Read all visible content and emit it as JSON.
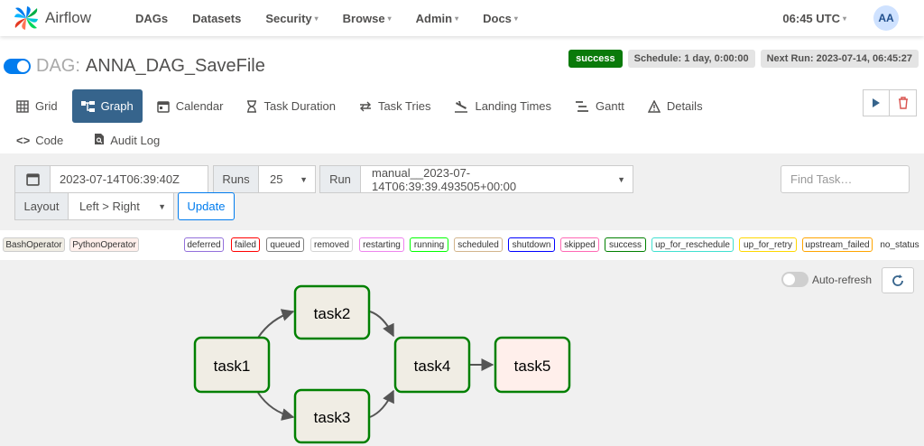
{
  "navbar": {
    "brand": "Airflow",
    "items": [
      {
        "label": "DAGs",
        "dropdown": false
      },
      {
        "label": "Datasets",
        "dropdown": false
      },
      {
        "label": "Security",
        "dropdown": true
      },
      {
        "label": "Browse",
        "dropdown": true
      },
      {
        "label": "Admin",
        "dropdown": true
      },
      {
        "label": "Docs",
        "dropdown": true
      }
    ],
    "clock": "06:45 UTC",
    "avatar": "AA"
  },
  "dag": {
    "prefix": "DAG:",
    "name": "ANNA_DAG_SaveFile",
    "paused": false
  },
  "status": {
    "state": "success",
    "schedule": "Schedule: 1 day, 0:00:00",
    "next_run": "Next Run: 2023-07-14, 06:45:27"
  },
  "tabs": [
    {
      "label": "Grid",
      "icon": "grid-icon"
    },
    {
      "label": "Graph",
      "icon": "graph-icon",
      "active": true
    },
    {
      "label": "Calendar",
      "icon": "calendar-icon"
    },
    {
      "label": "Task Duration",
      "icon": "hourglass-icon"
    },
    {
      "label": "Task Tries",
      "icon": "retry-icon"
    },
    {
      "label": "Landing Times",
      "icon": "landing-icon"
    },
    {
      "label": "Gantt",
      "icon": "gantt-icon"
    },
    {
      "label": "Details",
      "icon": "warning-icon"
    }
  ],
  "tabs2": [
    {
      "label": "Code",
      "icon": "code-icon"
    },
    {
      "label": "Audit Log",
      "icon": "audit-log-icon"
    }
  ],
  "filters": {
    "base_date": "2023-07-14T06:39:40Z",
    "runs_label": "Runs",
    "runs_value": "25",
    "run_label": "Run",
    "run_value": "manual__2023-07-14T06:39:39.493505+00:00",
    "layout_label": "Layout",
    "layout_value": "Left > Right",
    "update_label": "Update",
    "find_task_placeholder": "Find Task…"
  },
  "legend": {
    "operators": [
      {
        "label": "BashOperator",
        "color": "#f0ede4"
      },
      {
        "label": "PythonOperator",
        "color": "#ffefeb"
      }
    ],
    "states": [
      {
        "label": "deferred",
        "color": "#9370db"
      },
      {
        "label": "failed",
        "color": "#ff0000"
      },
      {
        "label": "queued",
        "color": "#808080"
      },
      {
        "label": "removed",
        "color": "#d3d3d3"
      },
      {
        "label": "restarting",
        "color": "#ee82ee"
      },
      {
        "label": "running",
        "color": "#00ff00"
      },
      {
        "label": "scheduled",
        "color": "#d2b48c"
      },
      {
        "label": "shutdown",
        "color": "#0000ff"
      },
      {
        "label": "skipped",
        "color": "#ff69b4"
      },
      {
        "label": "success",
        "color": "#008000"
      },
      {
        "label": "up_for_reschedule",
        "color": "#40e0d0"
      },
      {
        "label": "up_for_retry",
        "color": "#ffd700"
      },
      {
        "label": "upstream_failed",
        "color": "#ffa500"
      },
      {
        "label": "no_status",
        "color": ""
      }
    ]
  },
  "graph": {
    "auto_refresh_label": "Auto-refresh",
    "auto_refresh_on": false,
    "nodes": [
      {
        "id": "task1",
        "label": "task1",
        "operator": "BashOperator",
        "state": "success"
      },
      {
        "id": "task2",
        "label": "task2",
        "operator": "BashOperator",
        "state": "success"
      },
      {
        "id": "task3",
        "label": "task3",
        "operator": "BashOperator",
        "state": "success"
      },
      {
        "id": "task4",
        "label": "task4",
        "operator": "BashOperator",
        "state": "success"
      },
      {
        "id": "task5",
        "label": "task5",
        "operator": "PythonOperator",
        "state": "success"
      }
    ],
    "edges": [
      [
        "task1",
        "task2"
      ],
      [
        "task1",
        "task3"
      ],
      [
        "task2",
        "task4"
      ],
      [
        "task3",
        "task4"
      ],
      [
        "task4",
        "task5"
      ]
    ]
  }
}
